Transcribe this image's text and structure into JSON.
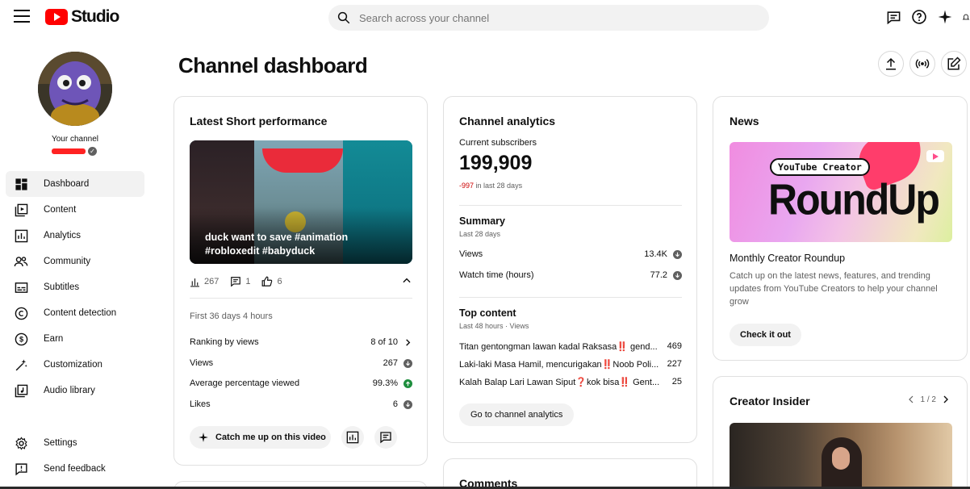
{
  "header": {
    "logo_text": "Studio",
    "search_placeholder": "Search across your channel"
  },
  "sidebar": {
    "your_channel": "Your channel",
    "items": [
      {
        "label": "Dashboard",
        "icon": "dashboard-icon",
        "active": true
      },
      {
        "label": "Content",
        "icon": "content-icon"
      },
      {
        "label": "Analytics",
        "icon": "analytics-icon"
      },
      {
        "label": "Community",
        "icon": "community-icon"
      },
      {
        "label": "Subtitles",
        "icon": "subtitles-icon"
      },
      {
        "label": "Content detection",
        "icon": "copyright-icon"
      },
      {
        "label": "Earn",
        "icon": "dollar-icon"
      },
      {
        "label": "Customization",
        "icon": "magic-wand-icon"
      },
      {
        "label": "Audio library",
        "icon": "audio-library-icon"
      }
    ],
    "bottom_items": [
      {
        "label": "Settings",
        "icon": "gear-icon"
      },
      {
        "label": "Send feedback",
        "icon": "feedback-icon"
      }
    ]
  },
  "page": {
    "title": "Channel dashboard"
  },
  "latest_short": {
    "title": "Latest Short performance",
    "video_caption": "duck want to save #animation #robloxedit #babyduck",
    "views_count": "267",
    "comments_count": "1",
    "likes_count": "6",
    "period": "First 36 days 4 hours",
    "metrics": [
      {
        "label": "Ranking by views",
        "value": "8 of 10",
        "indicator": "chevron"
      },
      {
        "label": "Views",
        "value": "267",
        "indicator": "down"
      },
      {
        "label": "Average percentage viewed",
        "value": "99.3%",
        "indicator": "up"
      },
      {
        "label": "Likes",
        "value": "6",
        "indicator": "down"
      }
    ],
    "catch_up_label": "Catch me up on this video"
  },
  "channel_analytics": {
    "title": "Channel analytics",
    "subs_label": "Current subscribers",
    "subs_value": "199,909",
    "subs_delta": "-997",
    "subs_delta_suffix": "in last 28 days",
    "summary_title": "Summary",
    "summary_sub": "Last 28 days",
    "summary_rows": [
      {
        "label": "Views",
        "value": "13.4K"
      },
      {
        "label": "Watch time (hours)",
        "value": "77.2"
      }
    ],
    "top_title": "Top content",
    "top_sub": "Last 48 hours · Views",
    "top_rows": [
      {
        "title": "Titan gentongman lawan kadal Raksasa‼️ gend...",
        "value": "469"
      },
      {
        "title": "Laki-laki Masa Hamil, mencurigakan‼️Noob Poli...",
        "value": "227"
      },
      {
        "title": "Kalah Balap Lari Lawan Siput❓kok bisa‼️ Gent...",
        "value": "25"
      }
    ],
    "go_button": "Go to channel analytics"
  },
  "news": {
    "title": "News",
    "image_tag": "YouTube Creator",
    "image_big": "RoundUp",
    "headline": "Monthly Creator Roundup",
    "body": "Catch up on the latest news, features, and trending updates from YouTube Creators to help your channel grow",
    "button": "Check it out"
  },
  "creator_insider": {
    "title": "Creator Insider",
    "pager": "1 / 2"
  },
  "comments": {
    "title": "Comments"
  },
  "colors": {
    "brand_red": "#ff0000",
    "negative": "#cc0000",
    "positive": "#1e8e3e"
  }
}
